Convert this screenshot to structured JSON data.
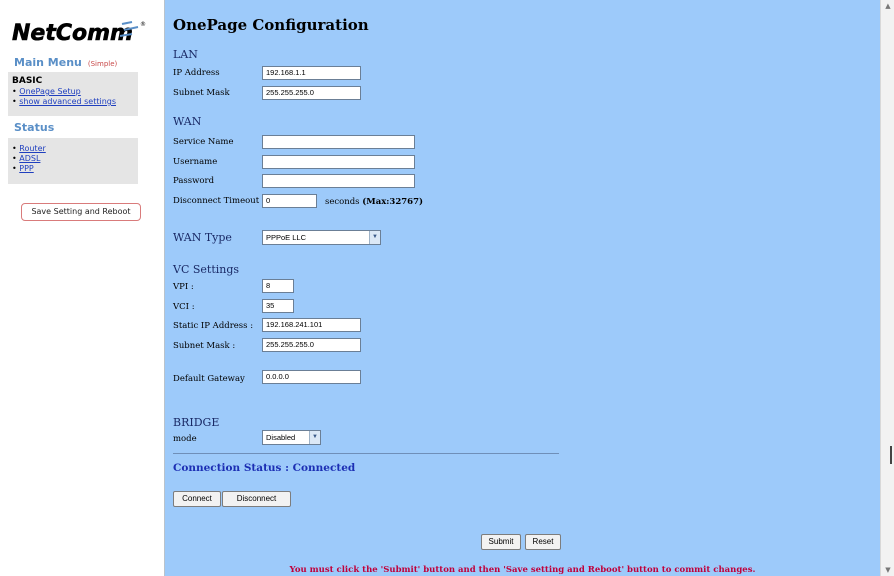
{
  "sidebar": {
    "main_menu": "Main Menu",
    "simple_tag": "(Simple)",
    "basic": {
      "title": "BASIC",
      "items": [
        "OnePage Setup",
        "show advanced settings"
      ]
    },
    "status_title": "Status",
    "status": {
      "items": [
        "Router",
        "ADSL",
        "PPP"
      ]
    },
    "save_button": "Save Setting and Reboot"
  },
  "main": {
    "title": "OnePage Configuration",
    "lan": {
      "heading": "LAN",
      "ip_label": "IP Address",
      "ip_value": "192.168.1.1",
      "mask_label": "Subnet Mask",
      "mask_value": "255.255.255.0"
    },
    "wan": {
      "heading": "WAN",
      "service_label": "Service Name",
      "service_value": "",
      "username_label": "Username",
      "username_value": "",
      "password_label": "Password",
      "password_value": "",
      "timeout_label": "Disconnect Timeout",
      "timeout_value": "0",
      "timeout_suffix": "seconds",
      "timeout_max": "(Max:32767)"
    },
    "wan_type": {
      "label": "WAN Type",
      "value": "PPPoE LLC"
    },
    "vc": {
      "heading": "VC Settings",
      "vpi_label": "VPI :",
      "vpi_value": "8",
      "vci_label": "VCI :",
      "vci_value": "35",
      "static_ip_label": "Static IP Address :",
      "static_ip_value": "192.168.241.101",
      "mask_label": "Subnet Mask :",
      "mask_value": "255.255.255.0",
      "gateway_label": "Default Gateway",
      "gateway_value": "0.0.0.0"
    },
    "bridge": {
      "heading": "BRIDGE",
      "mode_label": "mode",
      "mode_value": "Disabled"
    },
    "connection_status": "Connection Status : Connected",
    "connect_button": "Connect",
    "disconnect_button": "Disconnect",
    "submit_button": "Submit",
    "reset_button": "Reset",
    "notice": "You must click the 'Submit' button and then 'Save setting and Reboot' button to commit changes."
  },
  "colors": {
    "main_bg": "#9dcafa",
    "status_blue": "#1c2fb4",
    "notice_red": "#c0003a",
    "menu_blue": "#5a8fc7"
  }
}
